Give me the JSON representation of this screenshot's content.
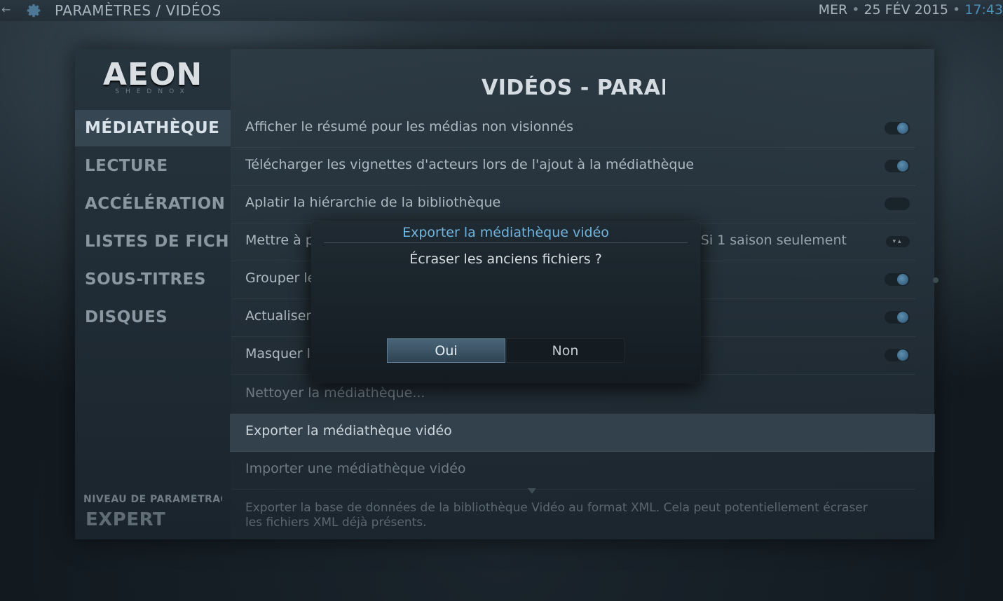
{
  "topbar": {
    "breadcrumb": "PARAMÈTRES / VIDÉOS",
    "day": "MER",
    "date": "25 FÉV 2015",
    "time": "17:43"
  },
  "logo": {
    "title": "AEON",
    "subtitle": "SHEDNOX"
  },
  "header": {
    "title": "VIDÉOS - PARAMÈTRES"
  },
  "categories": [
    {
      "label": "MÉDIATHÈQUE"
    },
    {
      "label": "LECTURE"
    },
    {
      "label": "ACCÉLÉRATION"
    },
    {
      "label": "LISTES DE FICHIE..."
    },
    {
      "label": "SOUS-TITRES"
    },
    {
      "label": "DISQUES"
    }
  ],
  "settings": [
    {
      "label": "Afficher le résumé pour les médias non visionnés",
      "control": "toggle",
      "state": "on"
    },
    {
      "label": "Télécharger les vignettes d'acteurs lors de l'ajout à la médiathèque",
      "control": "toggle",
      "state": "on"
    },
    {
      "label": "Aplatir la hiérarchie de la bibliothèque",
      "control": "toggle",
      "state": "off"
    },
    {
      "label": "Mettre à p",
      "control": "spinner",
      "value": "Si 1 saison seulement"
    },
    {
      "label": "Grouper le",
      "control": "toggle",
      "state": "on"
    },
    {
      "label": "Actualiser",
      "control": "toggle",
      "state": "on"
    },
    {
      "label": "Masquer l'",
      "control": "toggle",
      "state": "on"
    },
    {
      "label": "Nettoyer la médiathèque..."
    },
    {
      "label": "Exporter la médiathèque vidéo"
    },
    {
      "label": "Importer une médiathèque vidéo"
    }
  ],
  "description": "Exporter la base de données de la bibliothèque Vidéo au format XML. Cela peut potentiellement écraser les fichiers XML déjà présents.",
  "level": {
    "label": "NIVEAU DE PARAMÉTRAGE",
    "value": "EXPERT"
  },
  "dialog": {
    "title": "Exporter la médiathèque vidéo",
    "message": "Écraser les anciens fichiers ?",
    "yes": "Oui",
    "no": "Non"
  },
  "colors": {
    "accent": "#6fb5df",
    "toggle_on": "#4f86aa"
  }
}
